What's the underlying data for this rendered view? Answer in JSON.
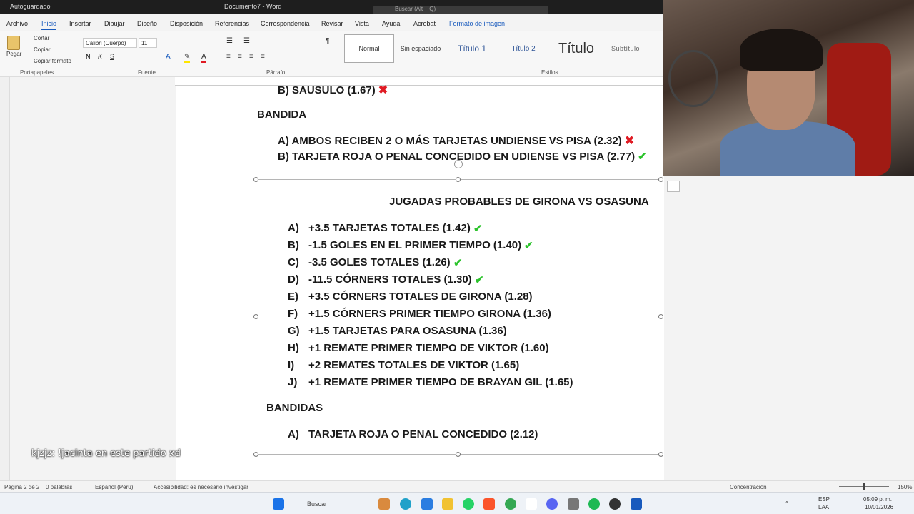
{
  "titlebar": {
    "autosave": "Autoguardado",
    "document": "Documento7 - Word",
    "search_placeholder": "Buscar (Alt + Q)"
  },
  "tabs": [
    "Archivo",
    "Inicio",
    "Insertar",
    "Dibujar",
    "Diseño",
    "Disposición",
    "Referencias",
    "Correspondencia",
    "Revisar",
    "Vista",
    "Ayuda",
    "Acrobat",
    "Formato de imagen"
  ],
  "ribbon": {
    "clipboard": {
      "paste": "Pegar",
      "cut": "Cortar",
      "copy": "Copiar",
      "format_painter": "Copiar formato",
      "label": "Portapapeles"
    },
    "font": {
      "name": "Calibri (Cuerpo)",
      "size": "11",
      "label": "Fuente"
    },
    "paragraph": {
      "label": "Párrafo"
    },
    "styles": {
      "items": [
        "Normal",
        "Sin espaciado",
        "Título 1",
        "Título 2",
        "Título",
        "Subtítulo"
      ],
      "label": "Estilos"
    }
  },
  "document": {
    "partial_line": "B)   SAUSULO (1.67)",
    "bandida_title": "BANDIDA",
    "bandida_items": [
      {
        "text": "A)   AMBOS RECIBEN 2 O MÁS TARJETAS UNDIENSE VS PISA (2.32)",
        "mark": "cross"
      },
      {
        "text": "B)   TARJETA ROJA O PENAL CONCEDIDO EN UDIENSE VS PISA (2.77)",
        "mark": "check"
      }
    ],
    "box_title": "JUGADAS PROBABLES DE GIRONA VS OSASUNA",
    "plays": [
      {
        "letter": "A)",
        "text": "+3.5 TARJETAS TOTALES (1.42)",
        "mark": "check"
      },
      {
        "letter": "B)",
        "text": "-1.5 GOLES EN EL PRIMER TIEMPO (1.40)",
        "mark": "check"
      },
      {
        "letter": "C)",
        "text": "-3.5 GOLES TOTALES (1.26)",
        "mark": "check"
      },
      {
        "letter": "D)",
        "text": "-11.5 CÓRNERS TOTALES (1.30)",
        "mark": "check"
      },
      {
        "letter": "E)",
        "text": "+3.5 CÓRNERS TOTALES DE GIRONA (1.28)",
        "mark": ""
      },
      {
        "letter": "F)",
        "text": "+1.5 CÓRNERS PRIMER TIEMPO GIRONA (1.36)",
        "mark": ""
      },
      {
        "letter": "G)",
        "text": "+1.5 TARJETAS PARA OSASUNA (1.36)",
        "mark": ""
      },
      {
        "letter": "H)",
        "text": "+1 REMATE PRIMER TIEMPO DE VIKTOR (1.60)",
        "mark": ""
      },
      {
        "letter": "I)",
        "text": "+2 REMATES TOTALES DE VIKTOR (1.65)",
        "mark": ""
      },
      {
        "letter": "J)",
        "text": "+1 REMATE PRIMER TIEMPO DE BRAYAN GIL (1.65)",
        "mark": ""
      }
    ],
    "bandidas_title": "BANDIDAS",
    "bandidas_items": [
      {
        "letter": "A)",
        "text": "TARJETA ROJA O PENAL CONCEDIDO (2.12)"
      }
    ]
  },
  "chat_overlay": "kjzjz: !jacinta en este partido xd",
  "statusbar": {
    "page": "Página 2 de 2",
    "words": "0 palabras",
    "language": "Español (Perú)",
    "accessibility": "Accesibilidad: es necesario investigar",
    "focus": "Concentración",
    "zoom": "150%"
  },
  "taskbar": {
    "search": "Buscar",
    "lang": "ESP",
    "lang2": "LAA",
    "time": "05:09 p. m.",
    "date": "10/01/2026"
  },
  "colors": {
    "check": "#2cc32c",
    "cross": "#e01b24",
    "accent": "#185abd"
  }
}
